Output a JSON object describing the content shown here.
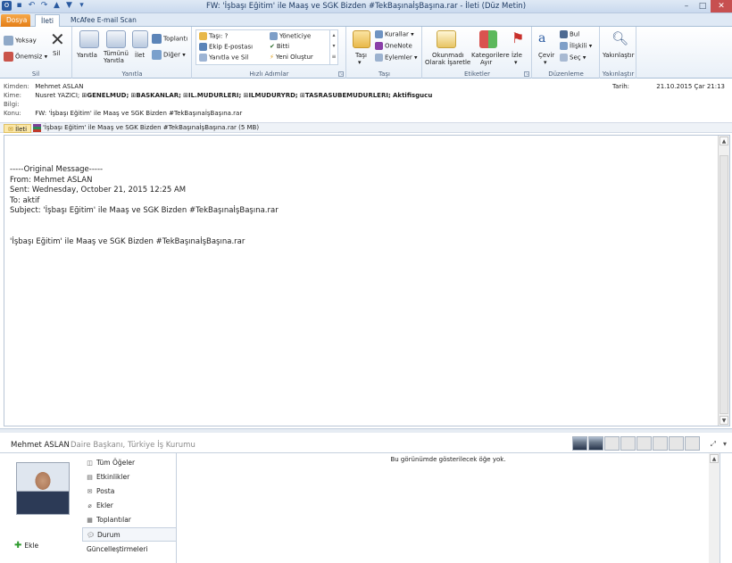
{
  "window": {
    "title": "FW: 'İşbaşı Eğitim' ile Maaş ve SGK Bizden #TekBaşınaİşBaşına.rar - İleti (Düz Metin)"
  },
  "tabs": [
    {
      "label": "Dosya"
    },
    {
      "label": "İleti"
    },
    {
      "label": "McAfee E-mail Scan"
    }
  ],
  "ribbon": {
    "groups": {
      "sil": {
        "label": "Sil",
        "yoksay": "Yoksay",
        "onemsiz": "Önemsiz",
        "sil": "Sil"
      },
      "yanitla": {
        "label": "Yanıtla",
        "yanitla": "Yanıtla",
        "tumunu_1": "Tümünü",
        "tumunu_2": "Yanıtla",
        "ilet": "İlet",
        "toplanti": "Toplantı",
        "diger": "Diğer"
      },
      "hizli": {
        "label": "Hızlı Adımlar",
        "items": [
          "Taşı: ?",
          "Ekip E-postası",
          "Yanıtla ve Sil",
          "Yöneticiye",
          "Bitti",
          "Yeni Oluştur"
        ]
      },
      "tasi": {
        "label": "Taşı",
        "tasi": "Taşı",
        "kurallar": "Kurallar",
        "onenote": "OneNote",
        "eylemler": "Eylemler"
      },
      "etiketler": {
        "label": "Etiketler",
        "okunmadi_1": "Okunmadı",
        "okunmadi_2": "Olarak İşaretle",
        "kategori_1": "Kategorilere",
        "kategori_2": "Ayır",
        "izle": "İzle"
      },
      "duzenleme": {
        "label": "Düzenleme",
        "cevir": "Çevir",
        "bul": "Bul",
        "iliskili": "İlişkili",
        "sec": "Seç"
      },
      "yakinlastir": {
        "label": "Yakınlaştır",
        "yakinlastir": "Yakınlaştır"
      }
    }
  },
  "header": {
    "from_label": "Kimden:",
    "from": "Mehmet ASLAN",
    "to_label": "Kime:",
    "to_plain": "Nusret YAZICI;",
    "to_groups": [
      "GENELMUD;",
      "BASKANLAR;",
      "IL.MUDURLERI;",
      "ILMUDURYRD;",
      "TASRASUBEMUDURLERI;"
    ],
    "to_last": "Aktifisgucu",
    "cc_label": "Bilgi:",
    "subject_label": "Konu:",
    "subject": "FW: 'İşbaşı Eğitim' ile Maaş ve SGK Bizden #TekBaşınaİşBaşına.rar",
    "date_label": "Tarih:",
    "date": "21.10.2015 Çar 21:13"
  },
  "attachments": {
    "message_tab": "İleti",
    "file": "'İşbaşı Eğitim' ile Maaş ve SGK Bizden #TekBaşınaİşBaşına.rar (5 MB)"
  },
  "body": {
    "text": "-----Original Message-----\nFrom: Mehmet ASLAN\nSent: Wednesday, October 21, 2015 12:25 AM\nTo: aktif\nSubject: 'İşbaşı Eğitim' ile Maaş ve SGK Bizden #TekBaşınaİşBaşına.rar\n\n\n'İşbaşı Eğitim' ile Maaş ve SGK Bizden #TekBaşınaİşBaşına.rar"
  },
  "people": {
    "name": "Mehmet ASLAN",
    "title": "Daire Başkanı, Türkiye İş Kurumu",
    "add_label": "Ekle",
    "nav": [
      {
        "label": "Tüm Öğeler",
        "icon": "all-items-icon"
      },
      {
        "label": "Etkinlikler",
        "icon": "activities-icon"
      },
      {
        "label": "Posta",
        "icon": "mail-icon"
      },
      {
        "label": "Ekler",
        "icon": "attachment-icon"
      },
      {
        "label": "Toplantılar",
        "icon": "meetings-icon"
      },
      {
        "label": "Durum Güncelleştirmeleri",
        "icon": "status-updates-icon"
      }
    ],
    "empty_message": "Bu görünümde gösterilecek öğe yok."
  }
}
